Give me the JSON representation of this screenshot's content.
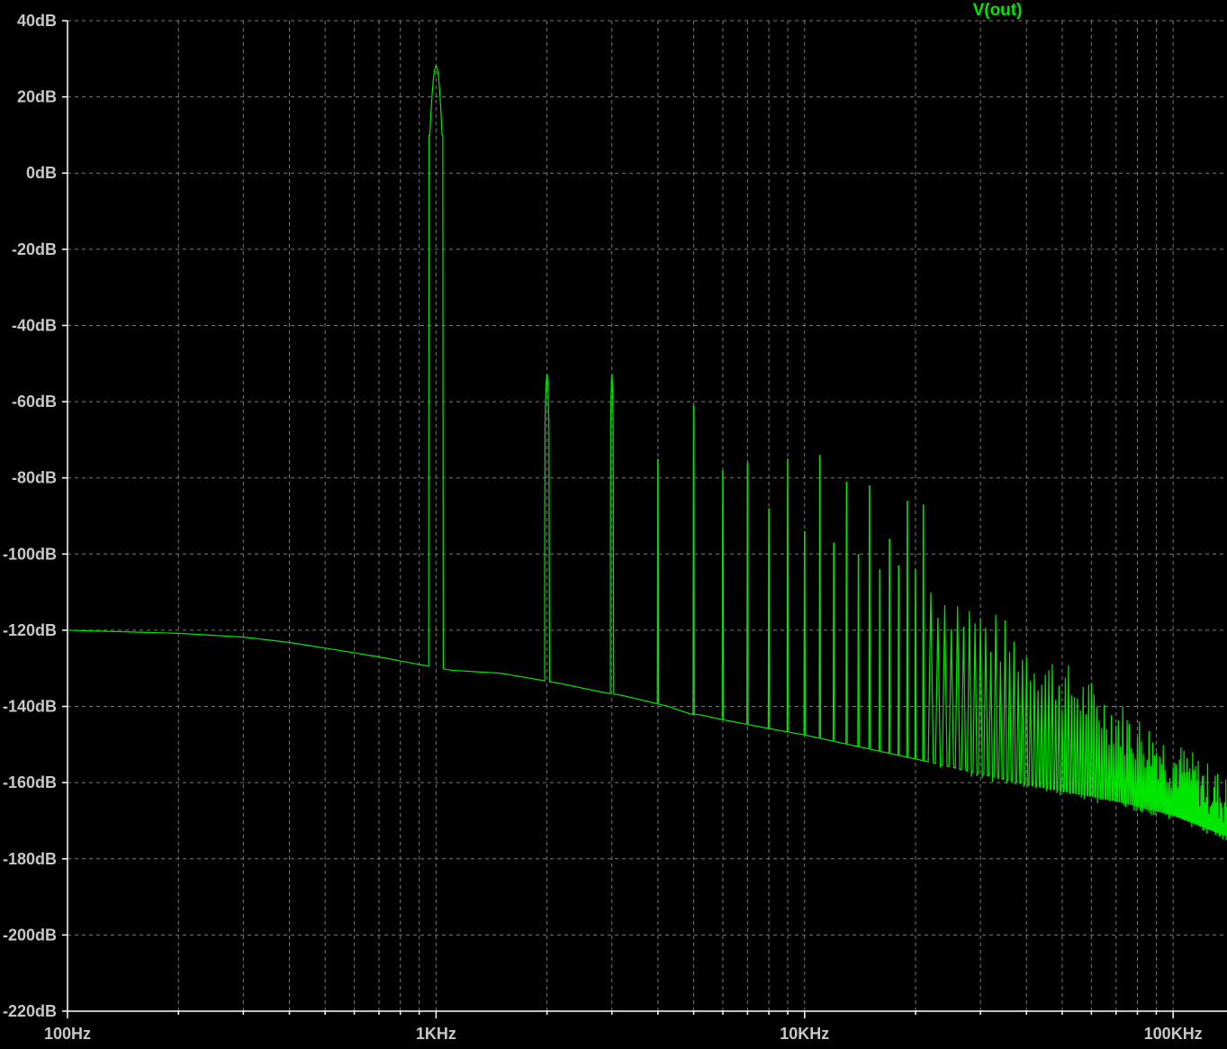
{
  "chart_data": {
    "type": "line",
    "title": "",
    "xlabel": "",
    "ylabel": "",
    "x_scale": "log",
    "xlim": [
      100,
      140000
    ],
    "ylim": [
      -220,
      40
    ],
    "grid": true,
    "x_tick_labels": [
      {
        "value": 100,
        "label": "100Hz"
      },
      {
        "value": 1000,
        "label": "1KHz"
      },
      {
        "value": 10000,
        "label": "10KHz"
      },
      {
        "value": 100000,
        "label": "100KHz"
      }
    ],
    "y_tick_labels": [
      {
        "value": 40,
        "label": "40dB"
      },
      {
        "value": 20,
        "label": "20dB"
      },
      {
        "value": 0,
        "label": "0dB"
      },
      {
        "value": -20,
        "label": "-20dB"
      },
      {
        "value": -40,
        "label": "-40dB"
      },
      {
        "value": -60,
        "label": "-60dB"
      },
      {
        "value": -80,
        "label": "-80dB"
      },
      {
        "value": -100,
        "label": "-100dB"
      },
      {
        "value": -120,
        "label": "-120dB"
      },
      {
        "value": -140,
        "label": "-140dB"
      },
      {
        "value": -160,
        "label": "-160dB"
      },
      {
        "value": -180,
        "label": "-180dB"
      },
      {
        "value": -200,
        "label": "-200dB"
      },
      {
        "value": -220,
        "label": "-220dB"
      }
    ],
    "series": [
      {
        "name": "V(out)",
        "color": "#00e600",
        "noise_floor": [
          [
            100,
            -120
          ],
          [
            200,
            -120.8
          ],
          [
            300,
            -121.8
          ],
          [
            400,
            -123.2
          ],
          [
            500,
            -124.7
          ],
          [
            700,
            -127
          ],
          [
            900,
            -129
          ],
          [
            1100,
            -130.5
          ],
          [
            1500,
            -131.3
          ],
          [
            1900,
            -133
          ],
          [
            2200,
            -134.1
          ],
          [
            2900,
            -136.5
          ],
          [
            3200,
            -137.1
          ],
          [
            3900,
            -139.1
          ],
          [
            4200,
            -139.8
          ],
          [
            4900,
            -142
          ],
          [
            5200,
            -142.2
          ],
          [
            6000,
            -143.5
          ],
          [
            8000,
            -145.8
          ],
          [
            10000,
            -147.5
          ],
          [
            20000,
            -153.8
          ],
          [
            40000,
            -160.5
          ],
          [
            70000,
            -164.8
          ],
          [
            100000,
            -168.5
          ],
          [
            140000,
            -174
          ]
        ],
        "peaks": [
          {
            "f": 1000,
            "db": 28
          },
          {
            "f": 2000,
            "db": -53
          },
          {
            "f": 3000,
            "db": -53
          },
          {
            "f": 4000,
            "db": -85
          },
          {
            "f": 5000,
            "db": -71
          },
          {
            "f": 6000,
            "db": -88
          },
          {
            "f": 7000,
            "db": -86
          },
          {
            "f": 8000,
            "db": -98
          },
          {
            "f": 9000,
            "db": -85
          },
          {
            "f": 10000,
            "db": -104
          },
          {
            "f": 11000,
            "db": -84
          },
          {
            "f": 12000,
            "db": -107
          },
          {
            "f": 13000,
            "db": -91
          },
          {
            "f": 14000,
            "db": -110
          },
          {
            "f": 15000,
            "db": -92
          },
          {
            "f": 16000,
            "db": -114
          },
          {
            "f": 17000,
            "db": -106
          },
          {
            "f": 18000,
            "db": -113
          },
          {
            "f": 19000,
            "db": -96
          },
          {
            "f": 20000,
            "db": -114
          },
          {
            "f": 21000,
            "db": -97
          }
        ],
        "dense_harmonics": {
          "f_start": 22000,
          "f_end": 140000,
          "spacing": 1000,
          "peak_db_start": -110,
          "peak_db_end": -165
        }
      }
    ]
  }
}
